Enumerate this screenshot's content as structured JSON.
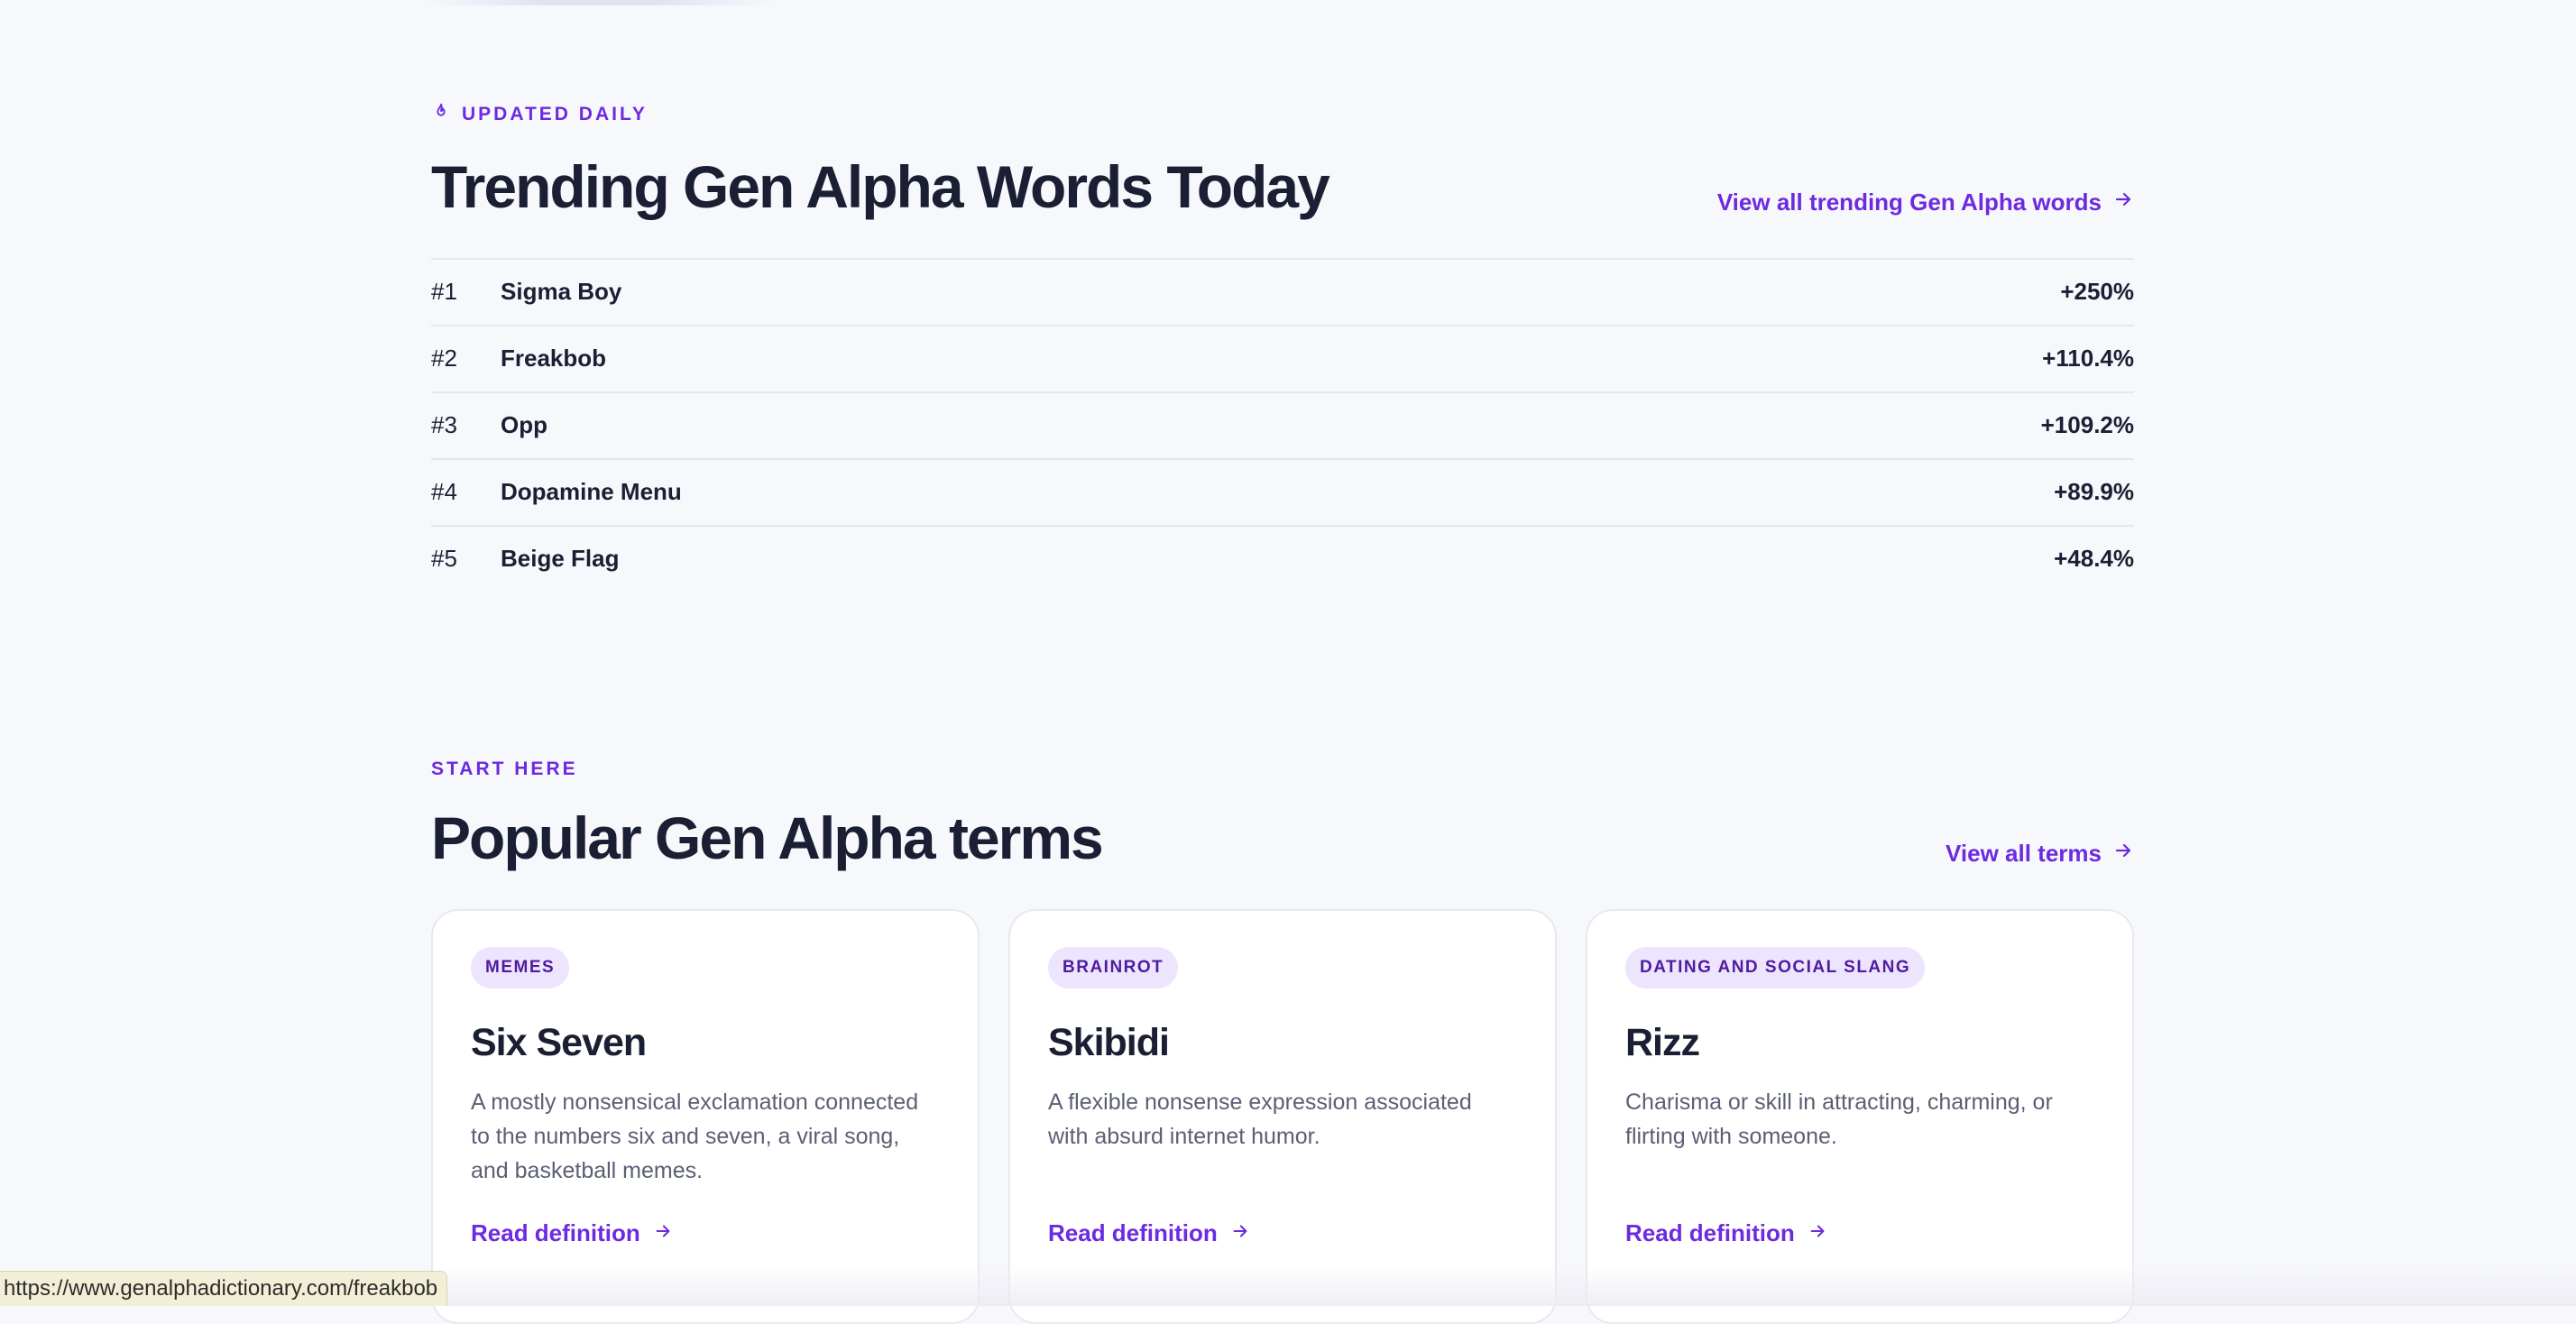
{
  "trending": {
    "eyebrow": "UPDATED DAILY",
    "eyebrow_icon": "flame-icon",
    "title": "Trending Gen Alpha Words Today",
    "view_all_label": "View all trending Gen Alpha words",
    "items": [
      {
        "rank": "#1",
        "word": "Sigma Boy",
        "change": "+250%"
      },
      {
        "rank": "#2",
        "word": "Freakbob",
        "change": "+110.4%"
      },
      {
        "rank": "#3",
        "word": "Opp",
        "change": "+109.2%"
      },
      {
        "rank": "#4",
        "word": "Dopamine Menu",
        "change": "+89.9%"
      },
      {
        "rank": "#5",
        "word": "Beige Flag",
        "change": "+48.4%"
      }
    ]
  },
  "popular": {
    "eyebrow": "START HERE",
    "title": "Popular Gen Alpha terms",
    "view_all_label": "View all terms",
    "cards": [
      {
        "badge": "MEMES",
        "title": "Six Seven",
        "description": "A mostly nonsensical exclamation connected to the numbers six and seven, a viral song, and basketball memes.",
        "link_label": "Read definition"
      },
      {
        "badge": "BRAINROT",
        "title": "Skibidi",
        "description": "A flexible nonsense expression associated with absurd internet humor.",
        "link_label": "Read definition"
      },
      {
        "badge": "DATING AND SOCIAL SLANG",
        "title": "Rizz",
        "description": "Charisma or skill in attracting, charming, or flirting with someone.",
        "link_label": "Read definition"
      }
    ]
  },
  "status_bar": {
    "url": "https://www.genalphadictionary.com/freakbob"
  },
  "colors": {
    "accent": "#6d2ae0",
    "heading": "#1b1f33",
    "background": "#f7f8fc",
    "badge_bg": "#ede4fe"
  }
}
